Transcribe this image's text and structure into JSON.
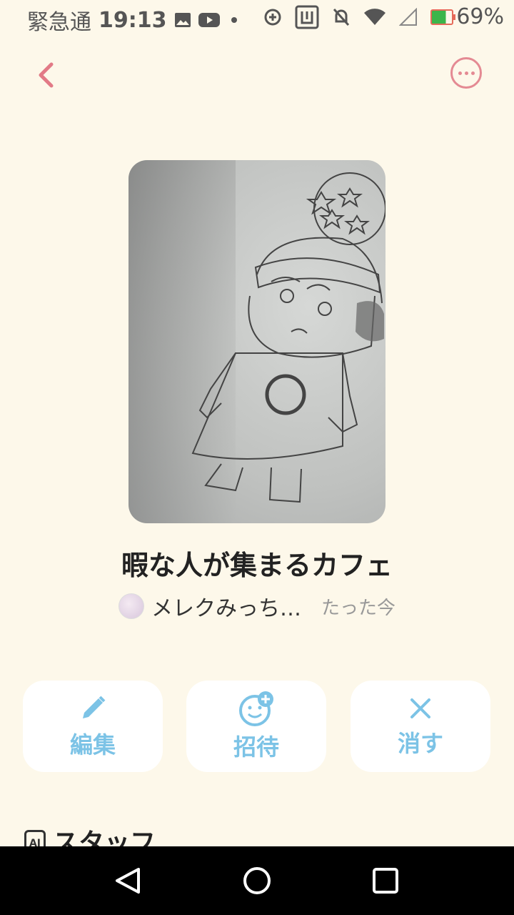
{
  "status_bar": {
    "carrier": "緊急通",
    "time": "19:13",
    "battery": "69%"
  },
  "room": {
    "title": "暇な人が集まるカフェ",
    "owner": "メレクみっち…",
    "timestamp": "たった今"
  },
  "actions": {
    "edit": "編集",
    "invite": "招待",
    "delete": "消す"
  },
  "staff": {
    "icon_text": "AI",
    "title": "スタッフ"
  },
  "colors": {
    "background": "#fdf8ea",
    "accent_pink": "#e48a93",
    "action_blue": "#7cc3e6"
  }
}
